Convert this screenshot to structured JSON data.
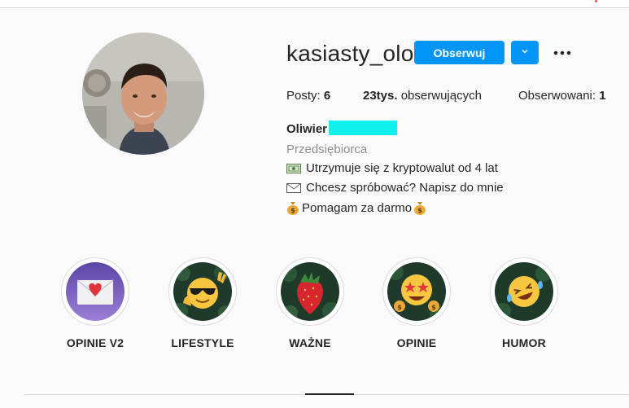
{
  "profile": {
    "username": "kasiasty_olo",
    "follow_label": "Obserwuj",
    "fullname": "Oliwier",
    "category": "Przedsiębiorca",
    "bio": [
      "Utrzymuje się z kryptowalut od 4 lat",
      "Chcesz spróbować? Napisz do mnie",
      "Pomagam za darmo"
    ]
  },
  "stats": {
    "posts_label": "Posty:",
    "posts_value": "6",
    "followers_value": "23tys.",
    "followers_label": "obserwujących",
    "following_label": "Obserwowani:",
    "following_value": "1"
  },
  "highlights": [
    {
      "label": "OPINIE V2",
      "icon": "love-letter-icon"
    },
    {
      "label": "LIFESTYLE",
      "icon": "sunglasses-face-icon"
    },
    {
      "label": "WAŻNE",
      "icon": "strawberry-icon"
    },
    {
      "label": "OPINIE",
      "icon": "star-struck-face-icon"
    },
    {
      "label": "HUMOR",
      "icon": "laughing-face-icon"
    }
  ],
  "colors": {
    "accent": "#0095f6",
    "redaction": "#12f0ee",
    "text": "#262626",
    "muted": "#8e8e8e",
    "background": "#fafafa"
  }
}
